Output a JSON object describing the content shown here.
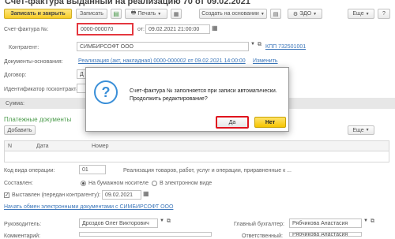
{
  "window": {
    "title": "Счет-фактура выданный на реализацию 70 от 09.02.2021"
  },
  "toolbar": {
    "post_close": "Записать и закрыть",
    "save": "Записать",
    "print": "Печать",
    "create_based_on": "Создать на основании",
    "edo": "ЭДО",
    "more": "Еще",
    "help": "?"
  },
  "form": {
    "invoice_label": "Счет-фактура №:",
    "invoice_number": "0000-000070",
    "date_label": "от:",
    "date_value": "09.02.2021 21:00:00",
    "counterparty_label": "Контрагент:",
    "counterparty_value": "СИМБИРСОФТ ООО",
    "kpp_link": "КПП 732501001",
    "basis_label": "Документы-основания:",
    "basis_link": "Реализация (акт, накладная) 0000-000002 от 09.02.2021 14:00:00",
    "change_link": "Изменить",
    "contract_label": "Договор:",
    "contract_value": "Д",
    "gov_id_label": "Идентификатор госконтракта:",
    "gov_id_value": "",
    "sum_label": "Сумма:",
    "payment_docs": "Платежные документы",
    "add_button": "Добавить",
    "more": "Еще",
    "table_headers": [
      "N",
      "Дата",
      "Номер"
    ],
    "operation_code_label": "Код вида операции:",
    "operation_code_value": "01",
    "operation_desc": "Реализация товаров, работ, услуг и операции, приравненные к ...",
    "composed_label": "Составлен:",
    "paper_option": "На бумажном носителе",
    "electronic_option": "В электронном виде",
    "issued_label": "Выставлен (передан контрагенту):",
    "issued_date": "09.02.2021",
    "edo_link": "Начать обмен электронными документами с СИМБИРСОФТ ООО",
    "head_label": "Руководитель:",
    "head_value": "Дроздов Олег Викторович",
    "chief_acc_label": "Главный бухгалтер:",
    "chief_acc_value": "Рябчикова Анастасия",
    "comment_label": "Комментарий:",
    "responsible_label": "Ответственный:",
    "responsible_value": "Рябчикова Анастасия"
  },
  "dialog": {
    "message_line1": "Счет-фактура № заполняется при записи автоматически.",
    "message_line2": "Продолжить редактирование?",
    "yes_button": "Да",
    "no_button": "Нет"
  }
}
